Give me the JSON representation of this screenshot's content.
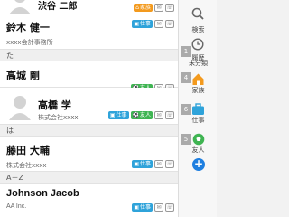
{
  "contacts": [
    {
      "name": "渋谷 二郎",
      "sub": "",
      "tags": [
        {
          "type": "family",
          "label": "家族"
        }
      ]
    },
    {
      "name": "鈴木 健一",
      "sub": "xxxx会計事務所",
      "tags": [
        {
          "type": "work",
          "label": "仕事"
        }
      ]
    },
    {
      "name": "高城 剛",
      "sub": "",
      "tags": [
        {
          "type": "friend",
          "label": "友人"
        }
      ]
    },
    {
      "name": "高橋 学",
      "sub": "株式会社xxxx",
      "tags": [
        {
          "type": "work",
          "label": "仕事"
        },
        {
          "type": "friend",
          "label": "友人"
        }
      ]
    },
    {
      "name": "藤田 大輔",
      "sub": "株式会社xxxx",
      "tags": [
        {
          "type": "work",
          "label": "仕事"
        }
      ]
    },
    {
      "name": "Johnson Jacob",
      "sub": "AA Inc.",
      "tags": [
        {
          "type": "work",
          "label": "仕事"
        }
      ]
    }
  ],
  "sections": {
    "ta": "た",
    "ha": "は",
    "az": "A－Z"
  },
  "sidebar": {
    "search": "検索",
    "history": "履歴",
    "uncategorized": {
      "count": "1",
      "label": "未分類"
    },
    "family": {
      "count": "4",
      "label": "家族"
    },
    "work": {
      "count": "6",
      "label": "仕事"
    },
    "friend": {
      "count": "5",
      "label": "友人"
    }
  },
  "icons": [
    "search-icon",
    "clock-icon",
    "house-icon",
    "briefcase-icon",
    "soccer-ball-icon",
    "plus-icon",
    "person-silhouette-icon",
    "mail-icon",
    "phone-icon"
  ],
  "colors": {
    "family": "#f39a1e",
    "work": "#2fa3da",
    "friend": "#3fb452",
    "add": "#1e7fe0"
  }
}
